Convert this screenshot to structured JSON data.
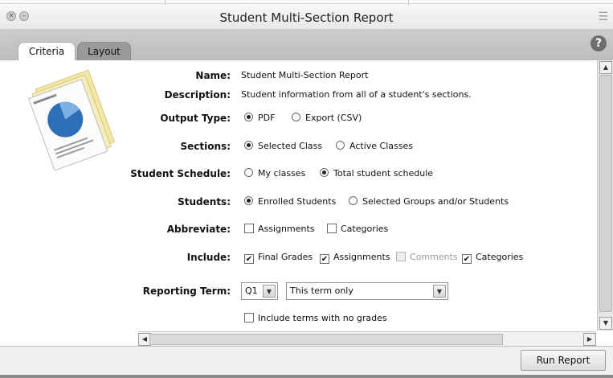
{
  "window": {
    "title": "Student Multi-Section Report"
  },
  "tabs": [
    {
      "label": "Criteria",
      "active": true
    },
    {
      "label": "Layout",
      "active": false
    }
  ],
  "help": {
    "glyph": "?"
  },
  "criteria": {
    "name": {
      "label": "Name:",
      "value": "Student Multi-Section Report"
    },
    "description": {
      "label": "Description:",
      "value": "Student information from all of a student's sections."
    },
    "output_type": {
      "label": "Output Type:",
      "options": [
        {
          "label": "PDF",
          "selected": true
        },
        {
          "label": "Export (CSV)",
          "selected": false
        }
      ]
    },
    "sections": {
      "label": "Sections:",
      "options": [
        {
          "label": "Selected Class",
          "selected": true
        },
        {
          "label": "Active Classes",
          "selected": false
        }
      ]
    },
    "student_schedule": {
      "label": "Student Schedule:",
      "options": [
        {
          "label": "My classes",
          "selected": false
        },
        {
          "label": "Total student schedule",
          "selected": true
        }
      ]
    },
    "students": {
      "label": "Students:",
      "options": [
        {
          "label": "Enrolled Students",
          "selected": true
        },
        {
          "label": "Selected Groups and/or Students",
          "selected": false
        }
      ]
    },
    "abbreviate": {
      "label": "Abbreviate:",
      "options": [
        {
          "label": "Assignments",
          "checked": false
        },
        {
          "label": "Categories",
          "checked": false
        }
      ]
    },
    "include": {
      "label": "Include:",
      "options": [
        {
          "label": "Final Grades",
          "checked": true
        },
        {
          "label": "Assignments",
          "checked": true
        },
        {
          "label": "Comments",
          "checked": false,
          "disabled": true
        },
        {
          "label": "Categories",
          "checked": true
        }
      ]
    },
    "reporting_term": {
      "label": "Reporting Term:",
      "term": "Q1",
      "range": "This term only"
    },
    "include_no_grades": {
      "label": "Include terms with no grades",
      "checked": false
    }
  },
  "footer": {
    "run_label": "Run Report"
  },
  "colors": {
    "tab_strip": "#c4c4c4",
    "inactive_tab": "#9a9a9a",
    "help": "#6e6e6e"
  }
}
